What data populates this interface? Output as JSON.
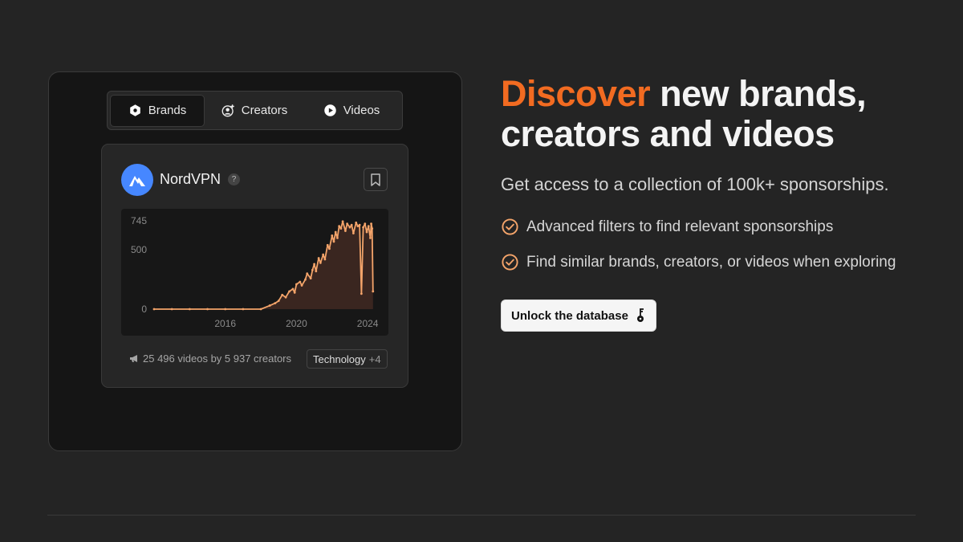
{
  "tabs": [
    {
      "label": "Brands",
      "icon": "hexagon-icon",
      "active": true
    },
    {
      "label": "Creators",
      "icon": "user-plus-icon",
      "active": false
    },
    {
      "label": "Videos",
      "icon": "play-icon",
      "active": false
    }
  ],
  "brand": {
    "name": "NordVPN",
    "help": "?"
  },
  "chart_data": {
    "type": "area",
    "y_ticks": [
      "745",
      "500",
      "0"
    ],
    "x_ticks": [
      "2016",
      "2020",
      "2024"
    ],
    "ylim": [
      0,
      745
    ],
    "xlim": [
      2012.0,
      2024.4
    ],
    "color": "#f4a46a",
    "x": [
      2012.0,
      2013.0,
      2014.0,
      2015.0,
      2016.0,
      2017.0,
      2018.0,
      2018.5,
      2018.8,
      2019.0,
      2019.2,
      2019.4,
      2019.6,
      2019.8,
      2019.9,
      2020.0,
      2020.2,
      2020.3,
      2020.5,
      2020.6,
      2020.8,
      2020.9,
      2021.0,
      2021.1,
      2021.25,
      2021.35,
      2021.5,
      2021.6,
      2021.75,
      2021.85,
      2022.0,
      2022.1,
      2022.2,
      2022.3,
      2022.4,
      2022.5,
      2022.6,
      2022.75,
      2022.85,
      2023.0,
      2023.1,
      2023.2,
      2023.35,
      2023.45,
      2023.55,
      2023.65,
      2023.75,
      2023.85,
      2023.95,
      2024.05,
      2024.15,
      2024.2,
      2024.25,
      2024.3
    ],
    "y": [
      0,
      0,
      0,
      0,
      0,
      0,
      0,
      30,
      50,
      70,
      120,
      100,
      150,
      170,
      140,
      210,
      230,
      200,
      250,
      300,
      260,
      330,
      380,
      320,
      430,
      390,
      460,
      420,
      540,
      510,
      620,
      570,
      650,
      600,
      700,
      680,
      740,
      660,
      720,
      690,
      710,
      640,
      730,
      700,
      710,
      130,
      690,
      720,
      650,
      700,
      600,
      720,
      680,
      150
    ],
    "total_text": "25 496 videos by 5 937 creators",
    "category": "Technology",
    "category_more": "+4"
  },
  "headline": {
    "accent": "Discover",
    "rest": "new brands, creators and videos"
  },
  "subheadline": "Get access to a collection of 100k+ sponsorships.",
  "features": [
    "Advanced filters to find relevant sponsorships",
    "Find similar brands, creators, or videos when exploring"
  ],
  "cta_label": "Unlock the database",
  "colors": {
    "accent": "#f26b21",
    "background": "#242424",
    "panel": "#151515",
    "brand_logo": "#4687ff"
  }
}
